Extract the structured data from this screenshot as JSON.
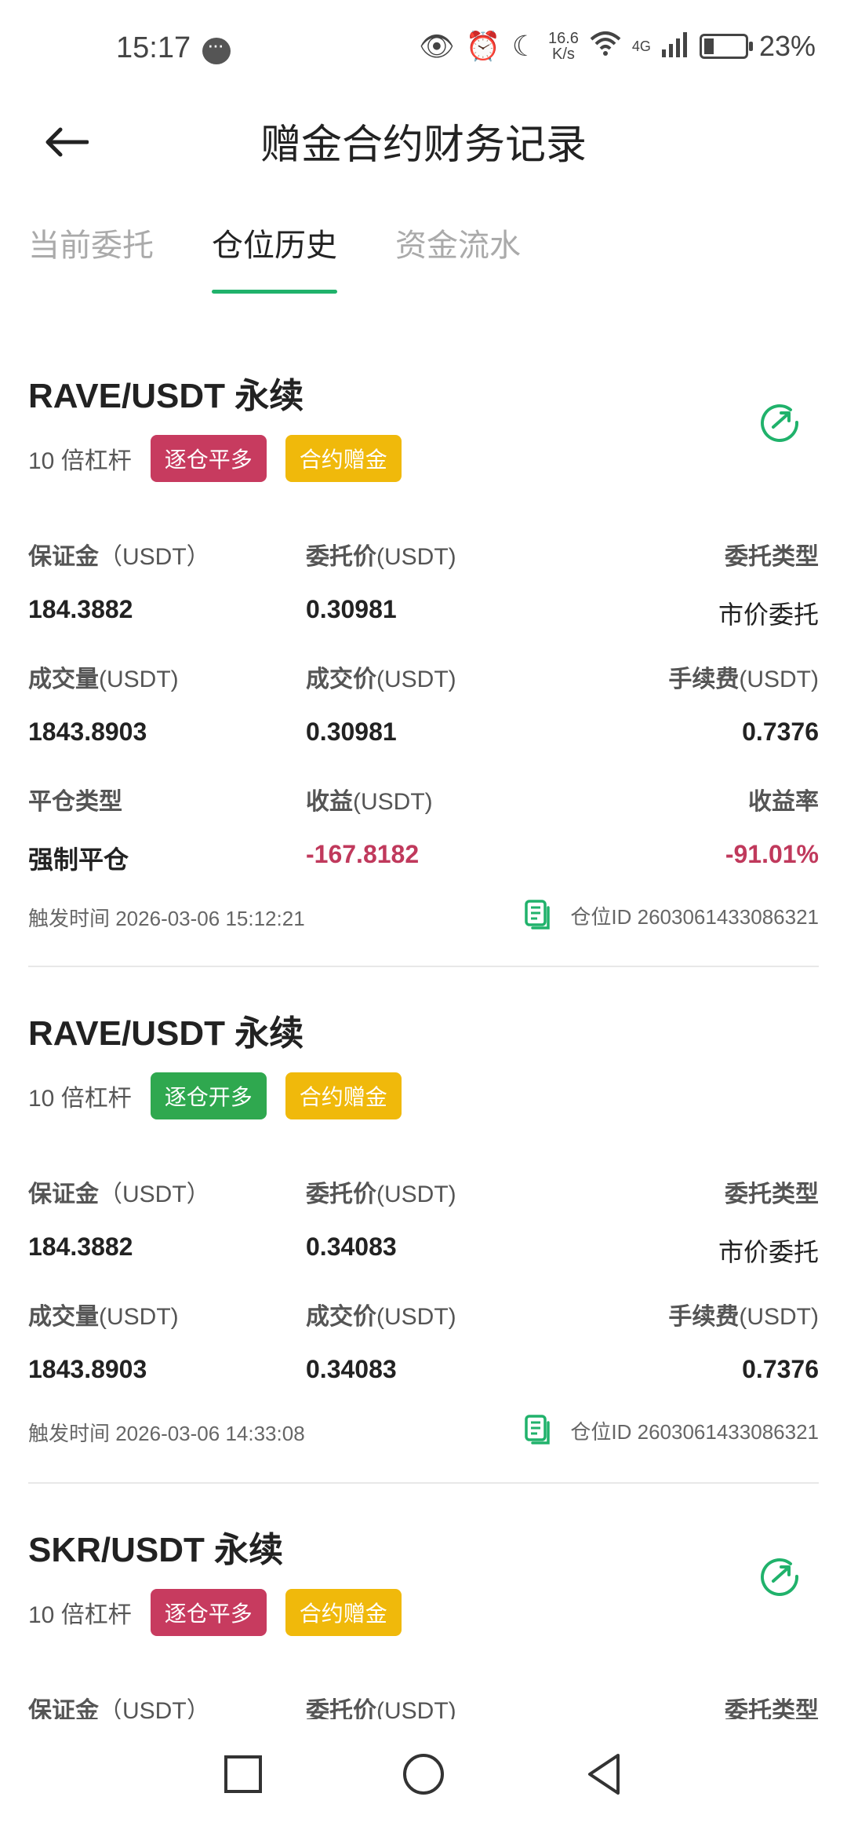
{
  "status_bar": {
    "time": "15:17",
    "speed_top": "16.6",
    "speed_bottom": "K/s",
    "network": "4G",
    "battery": "23%"
  },
  "header": {
    "title": "赠金合约财务记录",
    "back_icon": "back-arrow-icon"
  },
  "tabs": [
    {
      "label": "当前委托",
      "active": false
    },
    {
      "label": "仓位历史",
      "active": true
    },
    {
      "label": "资金流水",
      "active": false
    }
  ],
  "accent_color": "#20b26b",
  "records": [
    {
      "title": "RAVE/USDT 永续",
      "leverage": "10 倍杠杆",
      "tag1": "逐仓平多",
      "tag2": "合约赠金",
      "margin_label": "保证金",
      "margin_unit": "（USDT）",
      "margin": "184.3882",
      "order_price_label": "委托价",
      "order_price_unit": "(USDT)",
      "order_price": "0.30981",
      "order_type_label": "委托类型",
      "order_type": "市价委托",
      "volume_label": "成交量",
      "volume_unit": "(USDT)",
      "volume": "1843.8903",
      "fill_price_label": "成交价",
      "fill_price_unit": "(USDT)",
      "fill_price": "0.30981",
      "fee_label": "手续费",
      "fee_unit": "(USDT)",
      "fee": "0.7376",
      "close_type_label": "平仓类型",
      "close_type": "强制平仓",
      "pnl_label": "收益",
      "pnl_unit": "(USDT)",
      "pnl": "-167.8182",
      "pnl_rate_label": "收益率",
      "pnl_rate": "-91.01%",
      "trigger_time": "触发时间 2026-03-06 15:12:21",
      "position_id": "仓位ID 2603061433086321"
    },
    {
      "title": "RAVE/USDT 永续",
      "leverage": "10 倍杠杆",
      "tag1": "逐仓开多",
      "tag2": "合约赠金",
      "margin_label": "保证金",
      "margin_unit": "（USDT）",
      "margin": "184.3882",
      "order_price_label": "委托价",
      "order_price_unit": "(USDT)",
      "order_price": "0.34083",
      "order_type_label": "委托类型",
      "order_type": "市价委托",
      "volume_label": "成交量",
      "volume_unit": "(USDT)",
      "volume": "1843.8903",
      "fill_price_label": "成交价",
      "fill_price_unit": "(USDT)",
      "fill_price": "0.34083",
      "fee_label": "手续费",
      "fee_unit": "(USDT)",
      "fee": "0.7376",
      "trigger_time": "触发时间 2026-03-06 14:33:08",
      "position_id": "仓位ID 2603061433086321"
    },
    {
      "title": "SKR/USDT 永续",
      "leverage": "10 倍杠杆",
      "tag1": "逐仓平多",
      "tag2": "合约赠金",
      "margin_label": "保证金",
      "margin_unit": "（USDT）",
      "order_price_label": "委托价",
      "order_price_unit": "(USDT)",
      "order_type_label": "委托类型"
    }
  ],
  "nav": {
    "recent_icon": "square-recents-icon",
    "home_icon": "circle-home-icon",
    "back_icon": "triangle-back-icon"
  }
}
